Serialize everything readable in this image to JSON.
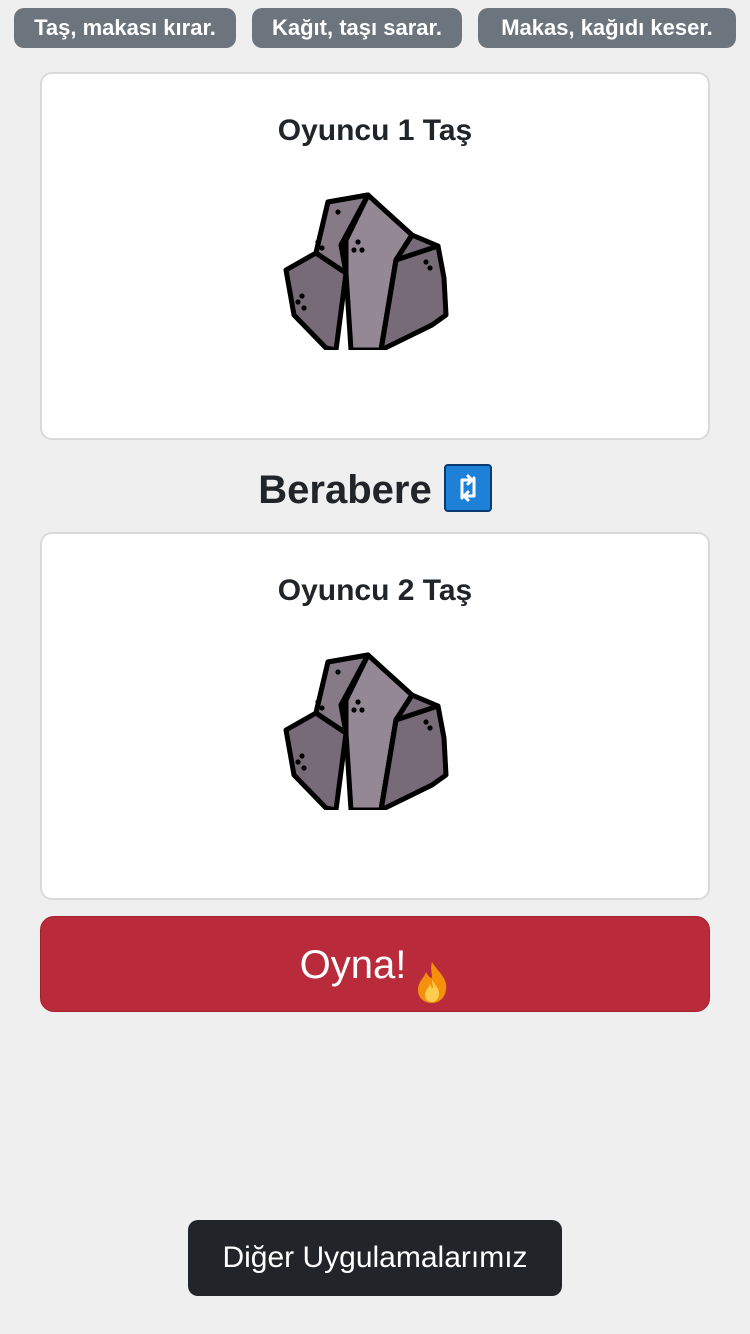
{
  "rules": {
    "rule1": "Taş, makası kırar.",
    "rule2": "Kağıt, taşı sarar.",
    "rule3": "Makas, kağıdı keser."
  },
  "player1": {
    "title": "Oyuncu 1 Taş",
    "choice_icon": "rock-icon"
  },
  "player2": {
    "title": "Oyuncu 2 Taş",
    "choice_icon": "rock-icon"
  },
  "result": {
    "text": "Berabere",
    "icon": "repeat-icon",
    "icon_color": "#1f80d8"
  },
  "play_button": {
    "label": "Oyna!",
    "icon": "fire-icon",
    "color": "#b92a3a"
  },
  "footer": {
    "other_apps_label": "Diğer Uygulamalarımız"
  },
  "colors": {
    "background": "#efefef",
    "badge": "#6c757d",
    "dark_button": "#212529"
  }
}
